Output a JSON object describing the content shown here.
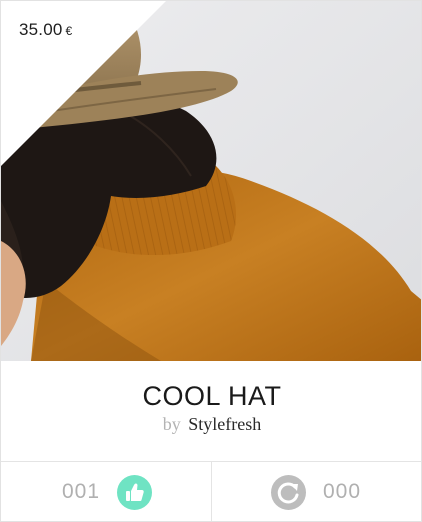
{
  "product": {
    "price": "35.00",
    "currency": "€",
    "title": "COOL HAT",
    "by_label": "by",
    "brand": "Stylefresh"
  },
  "stats": {
    "likes": "001",
    "reposts": "000"
  },
  "icons": {
    "like": "thumbs-up-icon",
    "repost": "repost-icon"
  },
  "colors": {
    "like_accent": "#6fe3c3",
    "repost_accent": "#bdbdbd",
    "count_text": "#b0b0b0",
    "sweater": "#c47a1e",
    "hat": "#a7895f",
    "hair": "#1e1714"
  }
}
